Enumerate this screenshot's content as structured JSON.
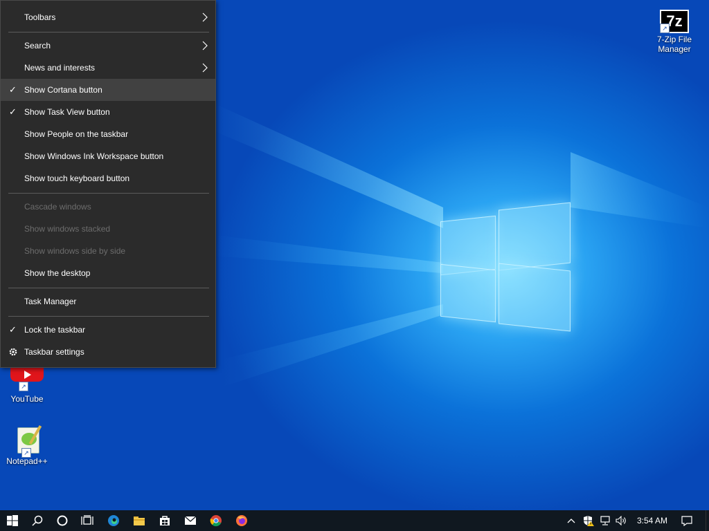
{
  "menu": {
    "items": [
      {
        "label": "Toolbars",
        "submenu": true
      },
      {
        "label": "Search",
        "submenu": true
      },
      {
        "label": "News and interests",
        "submenu": true
      },
      {
        "label": "Show Cortana button",
        "checked": true
      },
      {
        "label": "Show Task View button",
        "checked": true
      },
      {
        "label": "Show People on the taskbar"
      },
      {
        "label": "Show Windows Ink Workspace button"
      },
      {
        "label": "Show touch keyboard button"
      },
      {
        "label": "Cascade windows",
        "disabled": true
      },
      {
        "label": "Show windows stacked",
        "disabled": true
      },
      {
        "label": "Show windows side by side",
        "disabled": true
      },
      {
        "label": "Show the desktop"
      },
      {
        "label": "Task Manager"
      },
      {
        "label": "Lock the taskbar",
        "checked": true
      },
      {
        "label": "Taskbar settings",
        "icon": "gear-icon"
      }
    ]
  },
  "desktop": {
    "icons": [
      {
        "label": "7-Zip File Manager",
        "line1": "7-Zip File",
        "line2": "Manager",
        "glyph": "7z"
      },
      {
        "label": "YouTube"
      },
      {
        "label": "Notepad++"
      }
    ]
  },
  "taskbar": {
    "clock": "3:54 AM",
    "apps": [
      "start-icon",
      "search-icon",
      "cortana-icon",
      "task-view-icon",
      "edge-icon",
      "file-explorer-icon",
      "store-icon",
      "mail-icon",
      "chrome-icon",
      "firefox-icon"
    ]
  },
  "colors": {
    "menu_bg": "#2b2b2b",
    "menu_hover": "#414141",
    "taskbar_bg": "#101820",
    "desktop_blue": "#0b72d9"
  }
}
